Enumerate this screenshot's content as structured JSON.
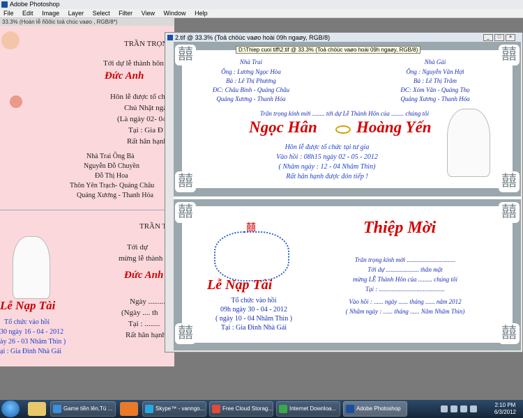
{
  "app": {
    "title": "Adobe Photoshop",
    "menu": [
      "File",
      "Edit",
      "Image",
      "Layer",
      "Select",
      "Filter",
      "View",
      "Window",
      "Help"
    ]
  },
  "doc_back": {
    "title": "33.3% (Hoàn lễ ñồôic toả chúc vaøo , RGB/8*)",
    "lines": [
      "TRẦN TRỌNG",
      "Tới dự lễ thành hôn c",
      "Đức Anh",
      "Hôn lễ được tổ ch",
      "Chủ Nhật ngà",
      "(Là ngày 02- 04",
      "Tại : Gia Đ",
      "Rất hân hạnh",
      "Nhà Trai Ông Bà",
      "Nguyễn Đỗ Chuyền",
      "Đỗ Thị Hoa",
      "Thôn Yên Trạch- Quảng Châu",
      "Quảng Xương - Thanh Hóa"
    ],
    "lower_lines": [
      "TRẦN T",
      "Tới dự",
      "mừng lễ thành h",
      "Đức Anh",
      "Ngày .........",
      "(Ngày .... th",
      "Tại : ........",
      "Rất hân hạnh"
    ],
    "left_lines": [
      "Lễ Nạp Tài",
      "Tổ chức vào hồi",
      "30 ngày 16 - 04 - 2012",
      "ày 26 - 03 Nhâm Thìn )",
      "ại : Gia Đình Nhà Gái"
    ]
  },
  "doc_front": {
    "title": "2.tif @ 33.3% (Toả chöùc vaøo hoài  09h ngaøy, RGB/8)",
    "tooltip": "D:\\Thiep cuoi tiff\\2.tif @ 33.3% (Toả chöùc vaøo hoài  09h ngaøy, RGB/8)"
  },
  "card_top": {
    "groom_side": [
      "Nhà Trai",
      "Ông : Lương Ngọc Hòa",
      "Bà : Lê Thị Phương",
      "ĐC: Châu Bình - Quảng Châu",
      "Quảng Xương - Thanh Hóa"
    ],
    "bride_side": [
      "Nhà Gái",
      "Ông : Nguyễn Văn Hợi",
      "Bà : Lê Thị Trâm",
      "ĐC: Xóm Văn - Quảng Thọ",
      "Quảng Xương - Thanh Hóa"
    ],
    "invite": "Trân trọng kính mời ........ tới dự Lễ Thành Hôn của ........ chúng tôi",
    "groom": "Ngọc Hân",
    "bride": "Hoàng Yến",
    "lines": [
      "Hôn lễ được tổ chức tại tư gia",
      "Vào hồi : 08h15 ngày 02 - 05 - 2012",
      "( Nhâm ngày : 12 - 04 Nhâm Thìn)",
      "Rất hân hạnh được đón tiếp !"
    ]
  },
  "card_bottom": {
    "title": "Thiệp Mời",
    "ceremony": "Lễ Nạp Tài",
    "left_lines": [
      "Tổ chức vào hồi",
      "09h ngày 30 - 04 - 2012",
      "( ngày 10 - 04 Nhâm Thìn )",
      "Tại : Gia Đình Nhà Gái"
    ],
    "right_lines": [
      "Trân trọng kính mời ...............................",
      "Tới dự ..................... thân mật",
      "mừng LỄ Thành Hôn của ......... chúng tôi",
      "Tại : ..........................................",
      "Vào hồi : ...... ngày ...... tháng ...... năm 2012",
      "( Nhâm ngày : ...... tháng ...... Năm Nhâm Thìn)"
    ],
    "double_happiness": "囍"
  },
  "taskbar": {
    "tasks": [
      "Game tiền lên,Tú ...",
      "Skype™ - vanngo...",
      "Free Cloud Storag...",
      "Internet Downloa...",
      "Adobe Photoshop"
    ],
    "time": "2:10 PM",
    "date": "6/3/2012"
  },
  "icons": [
    "photoshop-icon",
    "start-orb-icon",
    "ie-icon",
    "explorer-icon",
    "media-player-icon",
    "skype-icon",
    "chrome-icon",
    "idm-icon"
  ]
}
